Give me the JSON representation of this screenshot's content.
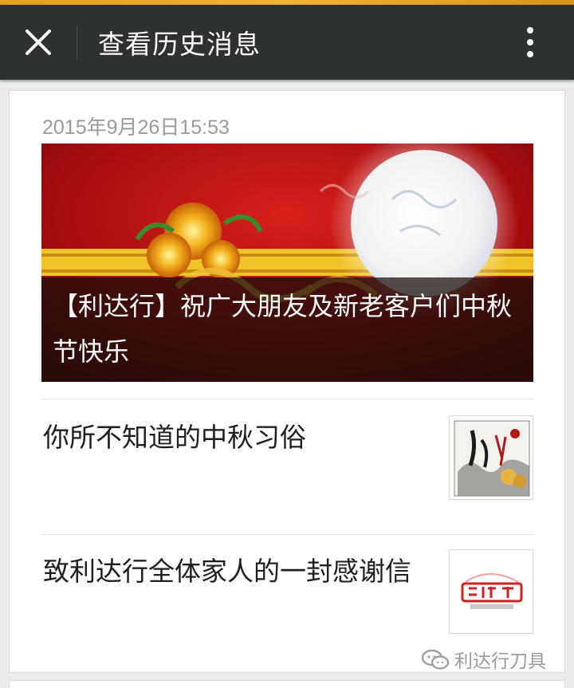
{
  "window": {
    "title": "查看历史消息",
    "close_icon": "close-icon",
    "more_icon": "more-vertical-icon"
  },
  "message": {
    "timestamp": "2015年9月26日15:53",
    "main_article": {
      "title": "【利达行】祝广大朋友及新老客户们中秋节快乐",
      "image": "mid-autumn-banner-image"
    },
    "articles": [
      {
        "title": "你所不知道的中秋习俗",
        "thumbnail": "mid-autumn-painting-thumbnail"
      },
      {
        "title": "致利达行全体家人的一封感谢信",
        "thumbnail": "thank-you-letter-thumbnail"
      }
    ]
  },
  "watermark": {
    "icon": "wechat-icon",
    "text": "利达行刀具"
  },
  "colors": {
    "title_bar": "#2e3132",
    "top_strip": "#e3a21a",
    "background": "#ebebeb",
    "timestamp_text": "#9a9a9a"
  }
}
